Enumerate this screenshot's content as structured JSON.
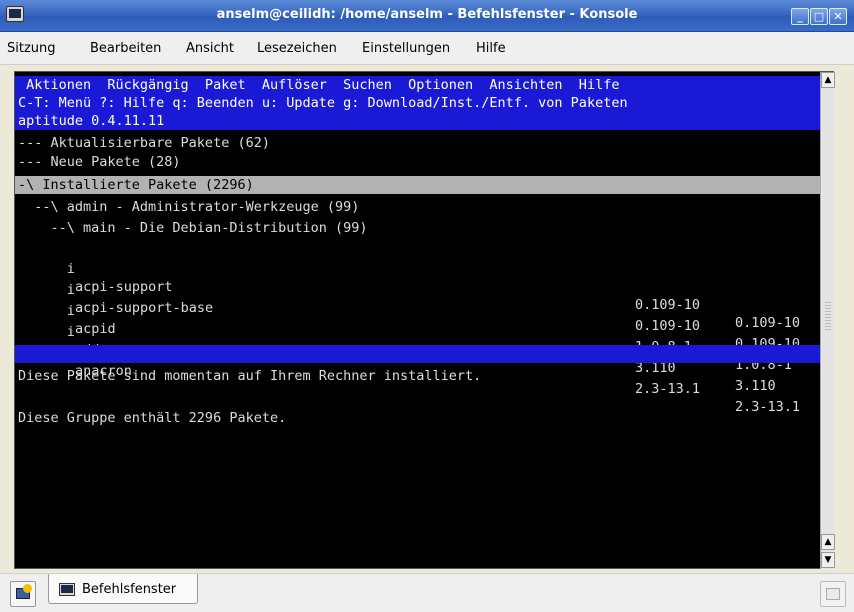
{
  "window": {
    "title": "anselm@ceilidh: /home/anselm - Befehlsfenster - Konsole",
    "buttons": {
      "minimize": "_",
      "maximize": "□",
      "close": "✕"
    }
  },
  "menubar": {
    "items": [
      "Sitzung",
      "Bearbeiten",
      "Ansicht",
      "Lesezeichen",
      "Einstellungen",
      "Hilfe"
    ]
  },
  "terminal": {
    "menu_line": " Aktionen  Rückgängig  Paket  Auflöser  Suchen  Optionen  Ansichten  Hilfe",
    "help_line": "C-T: Menü ?: Hilfe q: Beenden u: Update g: Download/Inst./Entf. von Paketen",
    "version_line": "aptitude 0.4.11.11",
    "groups": [
      "--- Aktualisierbare Pakete (62)",
      "--- Neue Pakete (28)",
      "-\\ Installierte Pakete (2296)",
      "  --\\ admin - Administrator-Werkzeuge (99)",
      "    --\\ main - Die Debian-Distribution (99)"
    ],
    "packages": [
      {
        "state": "i",
        "name": "acpi-support",
        "current": "0.109-10",
        "candidate": "0.109-10"
      },
      {
        "state": "i",
        "name": "acpi-support-base",
        "current": "0.109-10",
        "candidate": "0.109-10"
      },
      {
        "state": "i",
        "name": "acpid",
        "current": "1.0.8-1",
        "candidate": "1.0.8-1"
      },
      {
        "state": "i",
        "name": "adduser",
        "current": "3.110",
        "candidate": "3.110"
      },
      {
        "state": "i",
        "name": "anacron",
        "current": "2.3-13.1",
        "candidate": "2.3-13.1"
      }
    ],
    "description": [
      "Diese Pakete sind momentan auf Ihrem Rechner installiert.",
      "",
      "Diese Gruppe enthält 2296 Pakete."
    ]
  },
  "scrollbar": {
    "up": "▲",
    "down": "▼"
  },
  "tabbar": {
    "tab_label": "Befehlsfenster"
  },
  "colors": {
    "terminal_bg": "#000000",
    "header_blue": "#1a1ad6",
    "selection_gray": "#b2b2b2",
    "titlebar_blue": "#3968c2"
  }
}
